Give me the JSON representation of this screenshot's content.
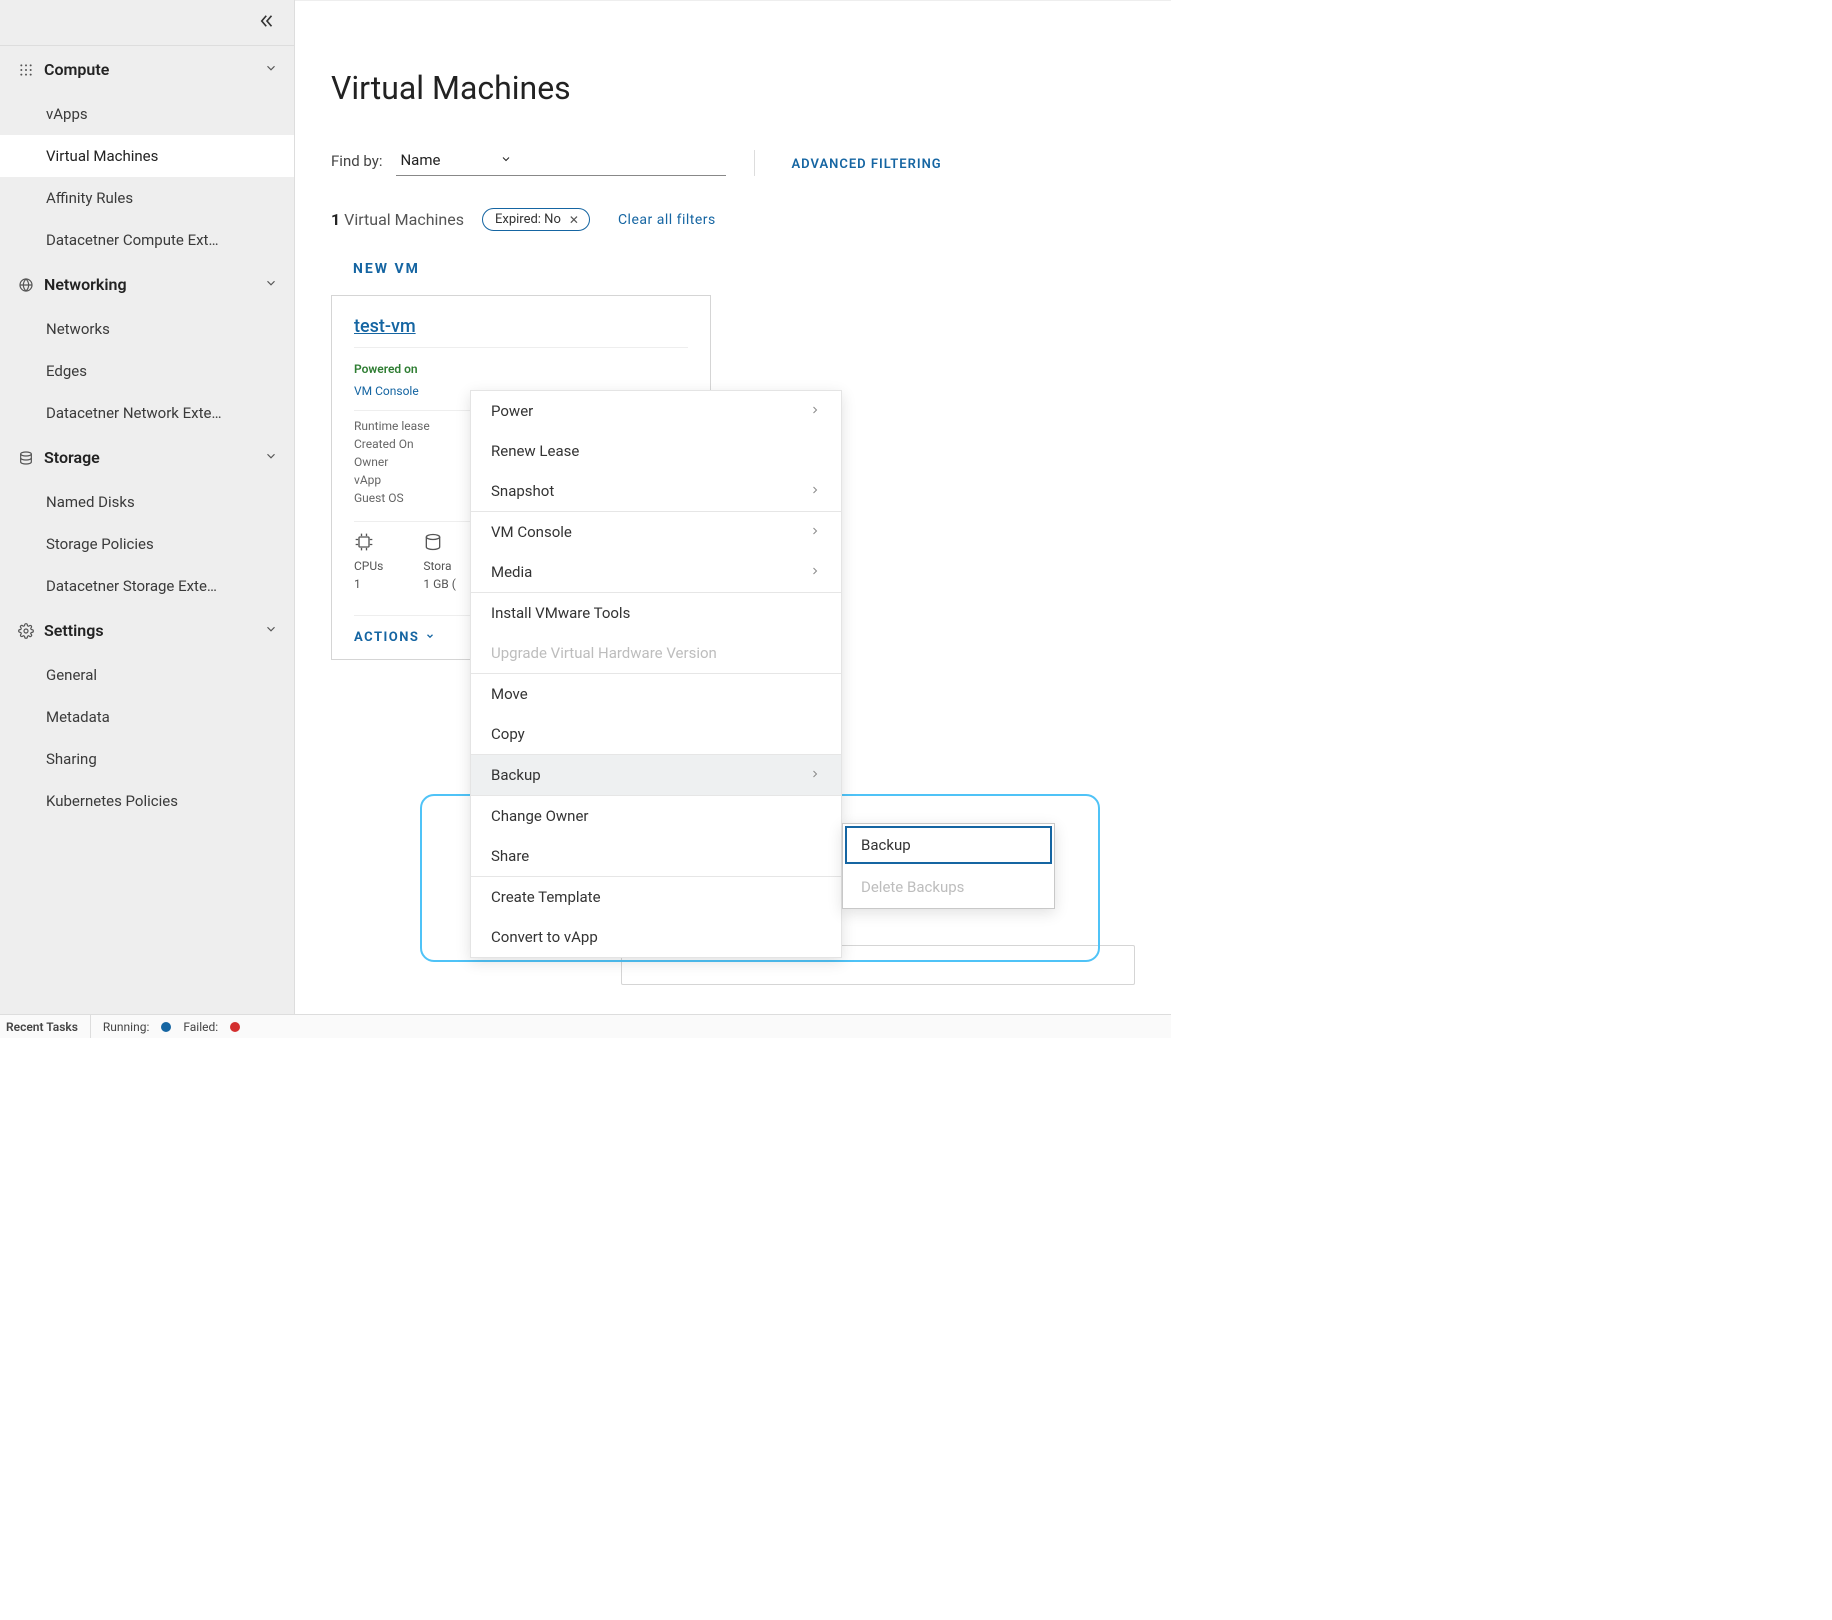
{
  "sidebar": {
    "sections": [
      {
        "id": "compute",
        "label": "Compute",
        "items": [
          "vApps",
          "Virtual Machines",
          "Affinity Rules",
          "Datacetner Compute Ext…"
        ]
      },
      {
        "id": "networking",
        "label": "Networking",
        "items": [
          "Networks",
          "Edges",
          "Datacetner Network Exte…"
        ]
      },
      {
        "id": "storage",
        "label": "Storage",
        "items": [
          "Named Disks",
          "Storage Policies",
          "Datacetner Storage Exte…"
        ]
      },
      {
        "id": "settings",
        "label": "Settings",
        "items": [
          "General",
          "Metadata",
          "Sharing",
          "Kubernetes Policies"
        ]
      }
    ],
    "active": "Virtual Machines"
  },
  "main": {
    "title": "Virtual Machines",
    "find_label": "Find by:",
    "find_field": "Name",
    "adv_filter_label": "ADVANCED FILTERING",
    "count_num": "1",
    "count_label": "Virtual Machines",
    "chip_label": "Expired: No",
    "clear_label": "Clear all filters",
    "new_vm_label": "NEW VM"
  },
  "card": {
    "name": "test-vm",
    "state": "Powered on",
    "console": "VM Console",
    "meta_labels": [
      "Runtime lease",
      "Created On",
      "Owner",
      "vApp",
      "Guest OS"
    ],
    "hw": {
      "cpus_label": "CPUs",
      "cpus_val": "1",
      "storage_label": "Stora",
      "storage_val": "1 GB ("
    },
    "actions_label": "ACTIONS"
  },
  "ctx": {
    "items": [
      {
        "label": "Power",
        "sub": true
      },
      {
        "label": "Renew Lease"
      },
      {
        "label": "Snapshot",
        "sub": true
      },
      {
        "sep": true
      },
      {
        "label": "VM Console",
        "sub": true
      },
      {
        "label": "Media",
        "sub": true
      },
      {
        "sep": true
      },
      {
        "label": "Install VMware Tools"
      },
      {
        "label": "Upgrade Virtual Hardware Version",
        "disabled": true
      },
      {
        "sep": true
      },
      {
        "label": "Move"
      },
      {
        "label": "Copy"
      },
      {
        "sep": true
      },
      {
        "label": "Backup",
        "sub": true,
        "hovered": true
      },
      {
        "sep": true
      },
      {
        "label": "Change Owner"
      },
      {
        "label": "Share"
      },
      {
        "sep": true
      },
      {
        "label": "Create Template"
      },
      {
        "label": "Convert to vApp"
      }
    ]
  },
  "subctx": {
    "items": [
      {
        "label": "Backup",
        "selected": true
      },
      {
        "label": "Delete Backups",
        "disabled": true
      }
    ]
  },
  "tasks": {
    "label": "Recent Tasks",
    "running": "Running:",
    "failed": "Failed:"
  }
}
